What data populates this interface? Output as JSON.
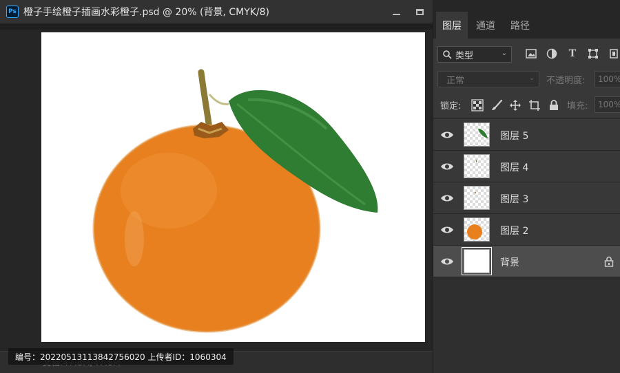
{
  "document": {
    "title": "橙子手绘橙子插画水彩橙子.psd @ 20% (背景, CMYK/8)",
    "app_badge": "Ps",
    "status_text": "文档:47.8M/47.8M",
    "id_banner": "编号：20220513113842756020 上传者ID：1060304"
  },
  "panel": {
    "tabs": [
      {
        "label": "图层",
        "active": true
      },
      {
        "label": "通道",
        "active": false
      },
      {
        "label": "路径",
        "active": false
      }
    ],
    "filter": {
      "label": "类型"
    },
    "blend_mode": "正常",
    "opacity_label": "不透明度:",
    "opacity_value": "100%",
    "lock_label": "锁定:",
    "fill_label": "填充:",
    "fill_value": "100%",
    "layers": [
      {
        "name": "图层 5",
        "visible": true,
        "selected": false,
        "locked": false
      },
      {
        "name": "图层 4",
        "visible": true,
        "selected": false,
        "locked": false
      },
      {
        "name": "图层 3",
        "visible": true,
        "selected": false,
        "locked": false
      },
      {
        "name": "图层 2",
        "visible": true,
        "selected": false,
        "locked": false
      },
      {
        "name": "背景",
        "visible": true,
        "selected": true,
        "locked": true
      }
    ]
  },
  "colors": {
    "orange": "#e8801f",
    "leaf": "#2f7d32",
    "stem": "#8a7a35",
    "ps_blue": "#31a8ff"
  }
}
